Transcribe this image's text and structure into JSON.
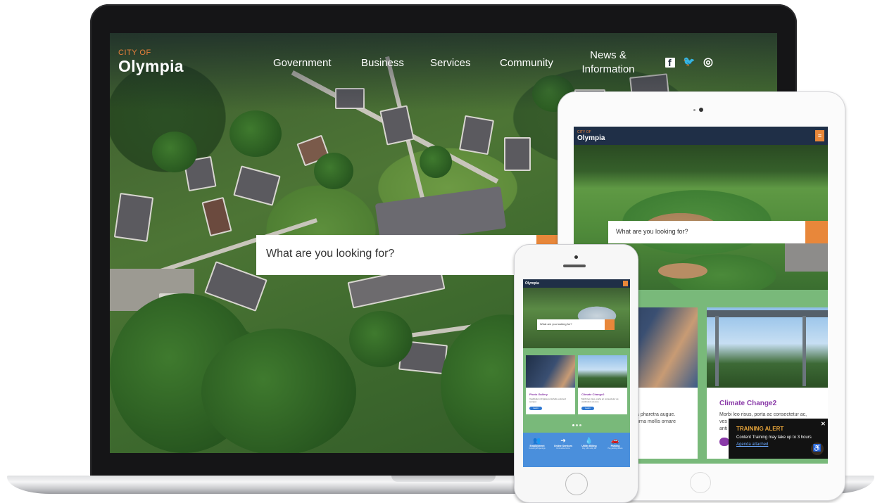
{
  "laptop": {
    "logo_small": "CITY OF",
    "logo_name": "Olympia",
    "nav": [
      "Government",
      "Business",
      "Services",
      "Community"
    ],
    "nav_news_line1": "News &",
    "nav_news_line2": "Information",
    "social": {
      "facebook": "f",
      "twitter": "🐦",
      "instagram": "◎"
    },
    "search_placeholder": "What are you looking for?"
  },
  "tablet": {
    "logo_small": "CITY OF",
    "logo_name": "Olympia",
    "menu_icon": "≡",
    "search_placeholder": "What are you looking for?",
    "card_left_text_1": "a pharetra augue.",
    "card_left_text_2": "urna mollis ornare",
    "card_right_title": "Climate Change2",
    "card_right_text_1": "Morbi leo risus, porta ac consectetur ac,",
    "card_right_text_2": "ves",
    "card_right_text_3": "anti",
    "alert": {
      "title": "TRAINING ALERT",
      "text": "Content Training may take up to 3 hours",
      "link": "Agenda attached",
      "close": "✕"
    },
    "accessibility_icon": "♿"
  },
  "phone": {
    "logo_name": "Olympia",
    "search_placeholder": "What are you looking for?",
    "cards": [
      {
        "title": "Photo Gallery",
        "text": "Vestibulum id ligula porta felis euismod semper.",
        "button": "Learn"
      },
      {
        "title": "Climate Change2",
        "text": "Morbi leo risus, porta ac consectetur ac, vestibulum at eros.",
        "button": "Learn"
      }
    ],
    "services": [
      {
        "label": "Employment",
        "icon": "👥",
        "text": "Current job openings"
      },
      {
        "label": "Online Services",
        "icon": "➜",
        "text": "Find online forms"
      },
      {
        "label": "Utility Billing",
        "icon": "💧",
        "text": "Pay your utility bill"
      },
      {
        "label": "Parking",
        "icon": "🚗",
        "text": "Pay parking tickets"
      }
    ]
  }
}
